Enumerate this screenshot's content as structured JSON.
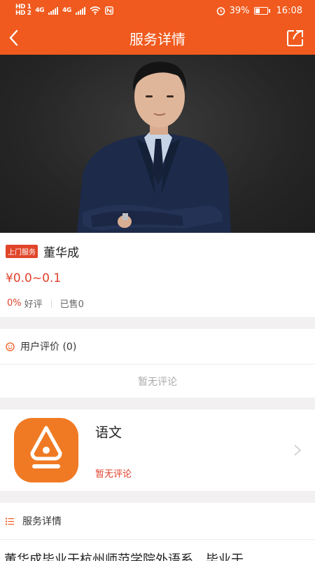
{
  "status_bar": {
    "left_indicators": [
      "HD 1",
      "HD 2",
      "4G",
      "4G"
    ],
    "battery": "39%",
    "time": "16:08"
  },
  "header": {
    "title": "服务详情",
    "back_icon": "chevron-left-icon",
    "share_icon": "share-icon"
  },
  "service": {
    "tag": "上门服务",
    "name": "董华成",
    "price": "¥0.0~0.1",
    "rating_pct": "0%",
    "rating_label": "好评",
    "sold": "已售0"
  },
  "reviews": {
    "title": "用户评价 (0)",
    "empty_text": "暂无评论"
  },
  "course": {
    "name": "语文",
    "subtitle": "暂无评论"
  },
  "details": {
    "title": "服务详情",
    "body": "董华成毕业于杭州师范学院外语系，毕业于"
  },
  "colors": {
    "brand": "#f05a1e",
    "accent_red": "#e2402c",
    "icon_orange": "#f07a23"
  }
}
